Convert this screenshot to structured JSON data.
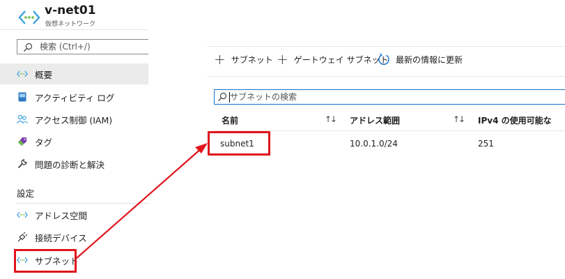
{
  "header": {
    "title": "v-net01",
    "subtitle": "仮想ネットワーク"
  },
  "sidebar": {
    "search_placeholder": "検索 (Ctrl+/)",
    "items": [
      {
        "label": "概要",
        "icon": "vnet-icon",
        "active": true
      },
      {
        "label": "アクティビティ ログ",
        "icon": "activity-log-icon"
      },
      {
        "label": "アクセス制御 (IAM)",
        "icon": "iam-users-icon"
      },
      {
        "label": "タグ",
        "icon": "tag-icon"
      },
      {
        "label": "問題の診断と解決",
        "icon": "wrench-icon"
      }
    ],
    "section_label": "設定",
    "settings_items": [
      {
        "label": "アドレス空間",
        "icon": "vnet-icon"
      },
      {
        "label": "接続デバイス",
        "icon": "plug-icon"
      },
      {
        "label": "サブネット",
        "icon": "vnet-icon"
      }
    ]
  },
  "toolbar": {
    "add_subnet": "サブネット",
    "add_gateway_subnet": "ゲートウェイ サブネット",
    "refresh": "最新の情報に更新"
  },
  "main": {
    "search_placeholder": "サブネットの検索",
    "table": {
      "columns": [
        "名前",
        "アドレス範囲",
        "IPv4 の使用可能な"
      ],
      "rows": [
        {
          "name": "subnet1",
          "address_range": "10.0.1.0/24",
          "available": "251"
        }
      ]
    }
  },
  "colors": {
    "accent_blue": "#1570c9",
    "annotation_red": "#e0141c",
    "active_bg": "#ebebeb"
  }
}
